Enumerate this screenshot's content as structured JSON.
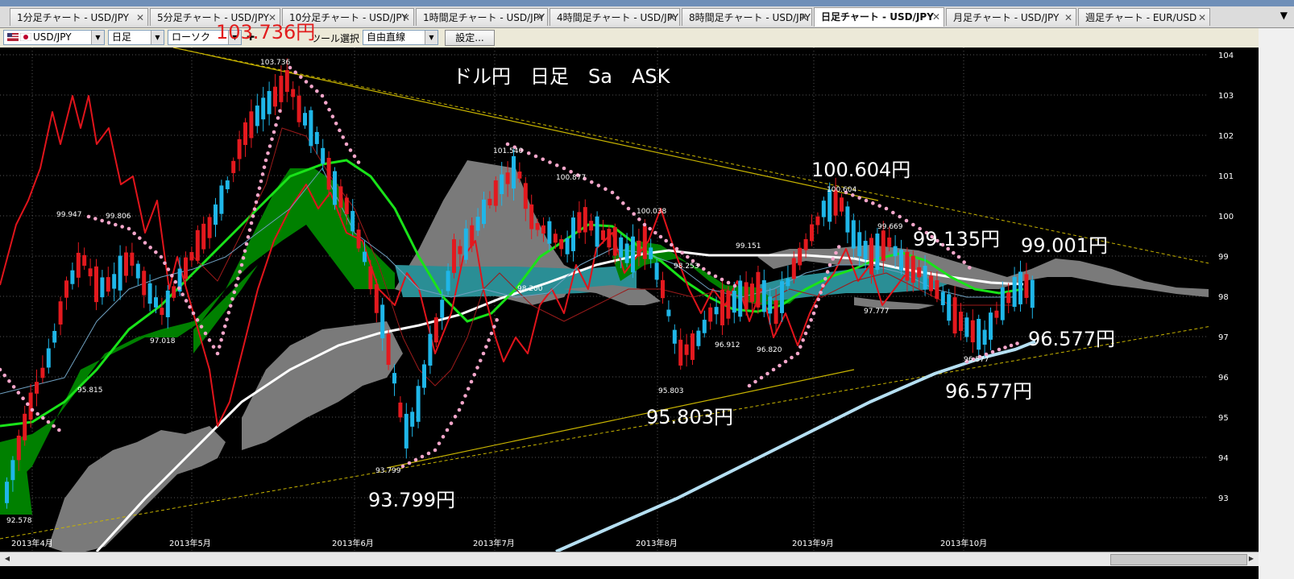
{
  "tabs": [
    {
      "label": "1分足チャート - USD/JPY",
      "active": false
    },
    {
      "label": "5分足チャート - USD/JPY",
      "active": false
    },
    {
      "label": "10分足チャート - USD/JPY",
      "active": false
    },
    {
      "label": "1時間足チャート - USD/JPY",
      "active": false
    },
    {
      "label": "4時間足チャート - USD/JPY",
      "active": false
    },
    {
      "label": "8時間足チャート - USD/JPY",
      "active": false
    },
    {
      "label": "日足チャート - USD/JPY",
      "active": true
    },
    {
      "label": "月足チャート - USD/JPY",
      "active": false
    },
    {
      "label": "週足チャート - EUR/USD",
      "active": false
    }
  ],
  "tab_close_glyph": "✕",
  "tab_menu_glyph": "▼",
  "toolbar": {
    "pair": "USD/JPY",
    "timeframe": "日足",
    "chart_type": "ローソク",
    "tool_label": "ツール選択",
    "tool_value": "自由直線",
    "settings_label": "設定..."
  },
  "overlay_price": "103.736円",
  "chart": {
    "title": "ドル円　日足　Sa　ASK",
    "y_ticks": [
      "104",
      "103",
      "102",
      "101",
      "100",
      "99",
      "98",
      "97",
      "96",
      "95",
      "94",
      "93"
    ],
    "x_ticks": [
      "2013年4月",
      "2013年5月",
      "2013年6月",
      "2013年7月",
      "2013年8月",
      "2013年9月",
      "2013年10月"
    ],
    "small_labels": [
      "103.736",
      "101.540",
      "100.877",
      "100.038",
      "100.604",
      "99.947",
      "99.806",
      "99.669",
      "99.151",
      "98.253",
      "98.200",
      "97.777",
      "97.018",
      "96.912",
      "96.820",
      "96.577",
      "95.815",
      "95.803",
      "93.799",
      "92.578"
    ],
    "big_labels": [
      "100.604円",
      "99.135円",
      "99.001円",
      "96.577円",
      "96.577円",
      "95.803円",
      "93.799円"
    ]
  },
  "colors": {
    "background": "#000000",
    "cloud_green": "#008000",
    "cloud_gray": "#7a7a7a",
    "cloud_teal": "#2a8e95",
    "candle_up": "#1fb6e8",
    "candle_down": "#e3191e",
    "ma_green": "#19e319",
    "ma_white": "#ffffff",
    "ma_lightblue": "#b5dff2",
    "lagging_red": "#e0141b",
    "parabolic": "#f4a6ca",
    "trend_yellow": "#c8b400"
  }
}
